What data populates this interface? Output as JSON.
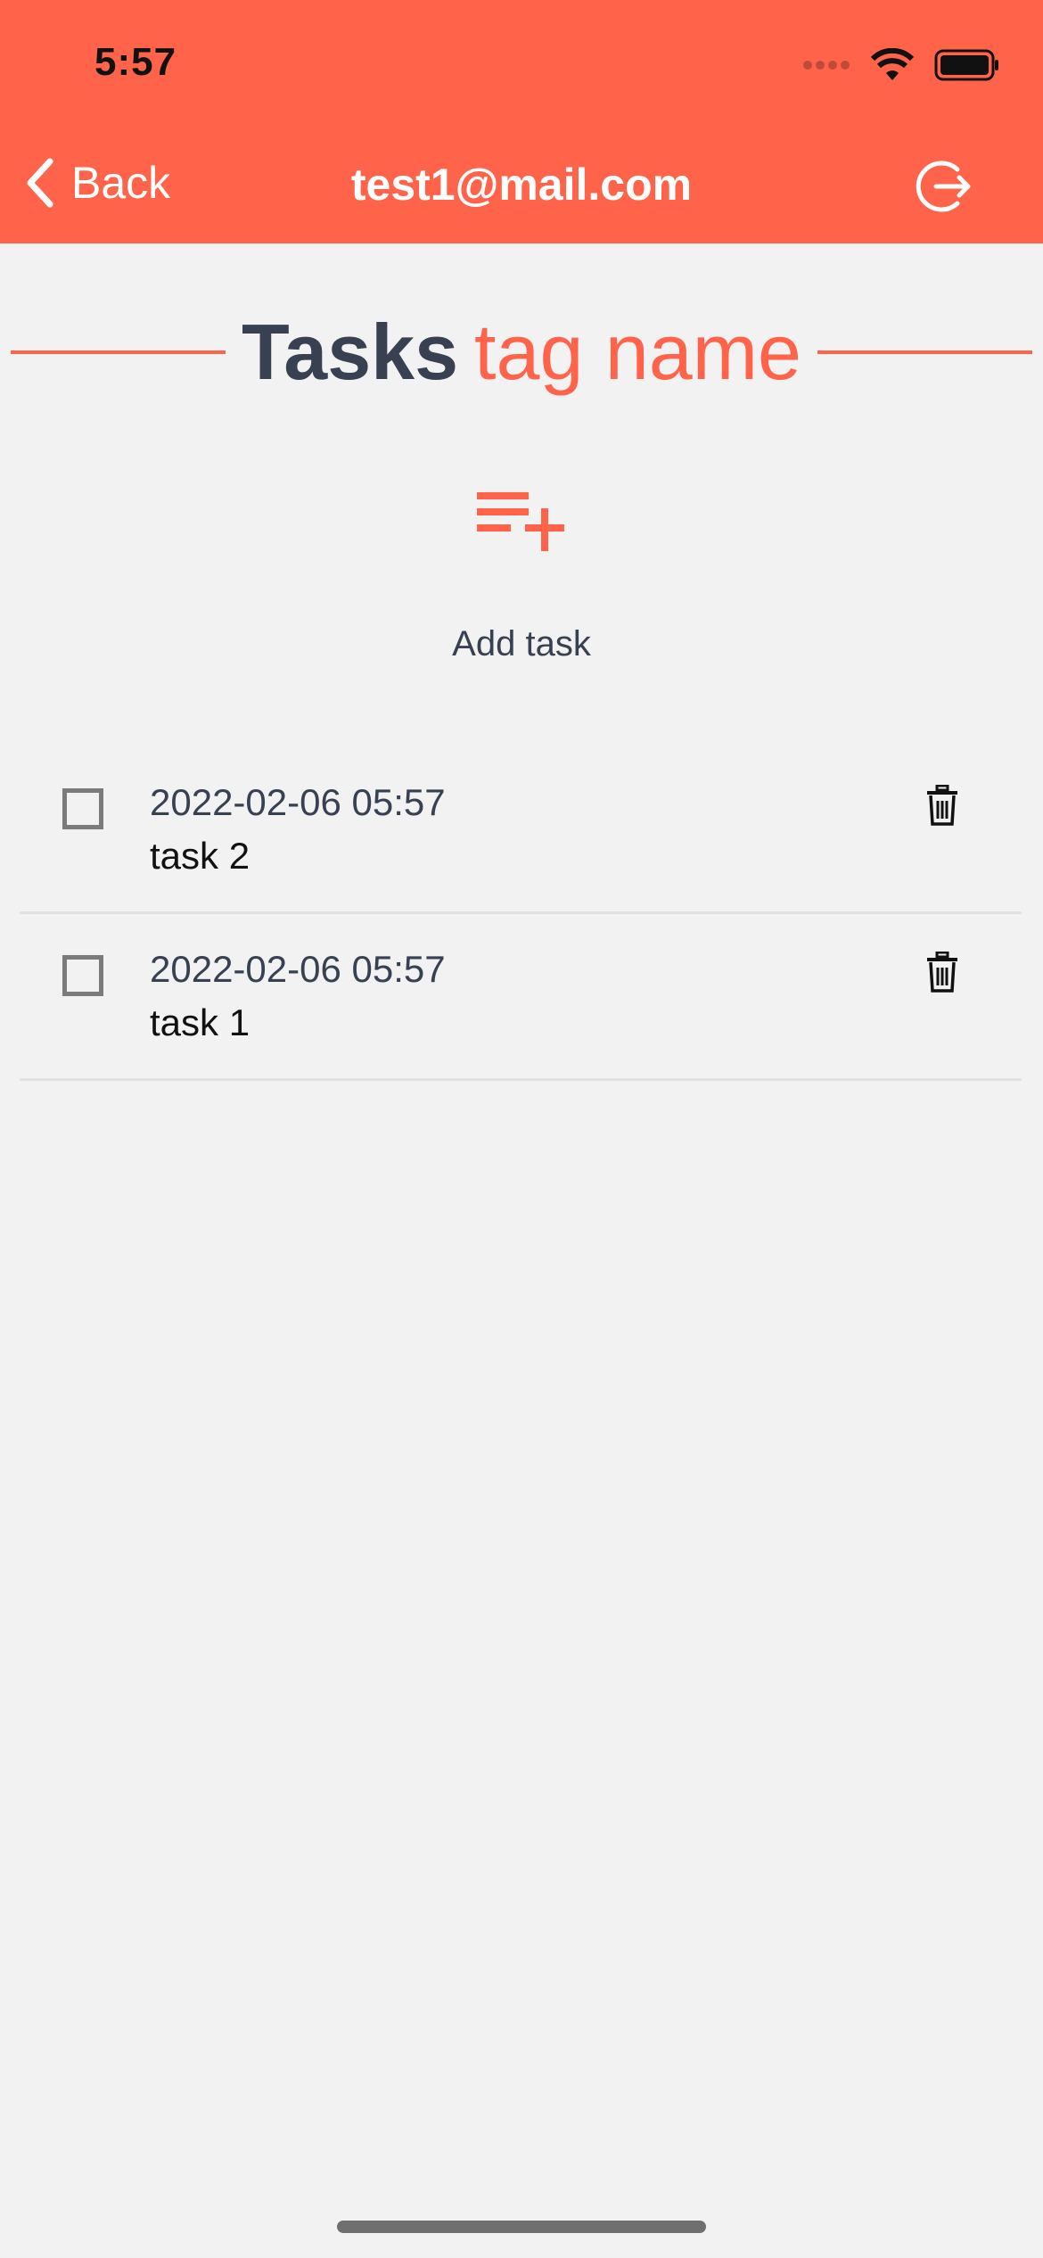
{
  "status_bar": {
    "time": "5:57"
  },
  "nav": {
    "back_label": "Back",
    "title": "test1@mail.com",
    "icons": {
      "back": "chevron-left-icon",
      "logout": "logout-icon"
    }
  },
  "section": {
    "title_bold": "Tasks",
    "title_tag": "tag name"
  },
  "add_task": {
    "label": "Add task",
    "icon": "playlist-add-icon"
  },
  "tasks": [
    {
      "date": "2022-02-06 05:57",
      "name": "task 2",
      "checked": false
    },
    {
      "date": "2022-02-06 05:57",
      "name": "task 1",
      "checked": false
    }
  ],
  "colors": {
    "accent": "#ff634a",
    "background": "#f2f2f2",
    "text_dark": "#374151"
  }
}
